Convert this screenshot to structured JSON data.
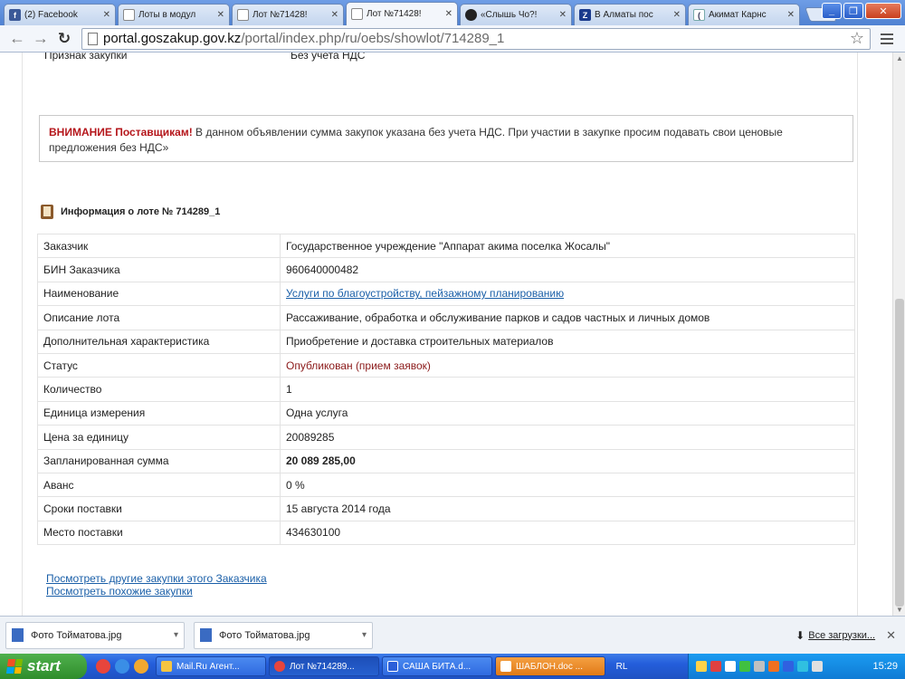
{
  "browser": {
    "tabs": [
      {
        "label": "(2) Facebook",
        "icon": "facebook-icon",
        "active": false
      },
      {
        "label": "Лоты в модул",
        "icon": "page-icon",
        "active": false
      },
      {
        "label": "Лот №71428!",
        "icon": "page-icon",
        "active": false
      },
      {
        "label": "Лот №71428!",
        "icon": "page-icon",
        "active": true
      },
      {
        "label": "«Слышь Чо?! ",
        "icon": "bomb-icon",
        "active": false
      },
      {
        "label": "В Алматы пос",
        "icon": "z-icon",
        "active": false
      },
      {
        "label": "Акимат Карнс",
        "icon": "crescent-icon",
        "active": false
      }
    ],
    "tab_close": "✕",
    "address_host": "portal.goszakup.gov.kz",
    "address_path": "/portal/index.php/ru/oebs/showlot/714289_1"
  },
  "page": {
    "top_row": {
      "label": "Признак закупки",
      "value": "Без учета НДС"
    },
    "notice": {
      "warning": "ВНИМАНИЕ Поставщикам!",
      "text": " В данном объявлении сумма закупок указана без учета НДС. При участии в закупке просим подавать свои ценовые предложения без НДС»"
    },
    "lot_heading": "Информация о лоте № 714289_1",
    "rows": [
      {
        "label": "Заказчик",
        "value": "Государственное учреждение \"Аппарат акима поселка Жосалы\""
      },
      {
        "label": "БИН Заказчика",
        "value": "960640000482"
      },
      {
        "label": "Наименование",
        "value": "Услуги по благоустройству, пейзажному планированию"
      },
      {
        "label": "Описание лота",
        "value": "Рассаживание, обработка и обслуживание  парков и садов частных и личных домов"
      },
      {
        "label": "Дополнительная характеристика",
        "value": "Приобретение и доставка строительных материалов"
      },
      {
        "label": "Статус",
        "value": "Опубликован (прием заявок)"
      },
      {
        "label": "Количество",
        "value": "1"
      },
      {
        "label": "Единица измерения",
        "value": "Одна услуга"
      },
      {
        "label": "Цена за единицу",
        "value": "20089285"
      },
      {
        "label": "Запланированная сумма",
        "value": "20 089 285,00"
      },
      {
        "label": "Аванс",
        "value": "0 %"
      },
      {
        "label": "Сроки поставки",
        "value": "15 августа 2014 года"
      },
      {
        "label": "Место поставки",
        "value": "434630100"
      }
    ],
    "links": {
      "other_purchases": "Посмотреть другие закупки этого Заказчика",
      "similar_purchases": "Посмотреть похожие закупки"
    }
  },
  "downloads": {
    "items": [
      "Фото Тойматова.jpg",
      "Фото Тойматова.jpg"
    ],
    "show_all": "Все загрузки..."
  },
  "taskbar": {
    "start": "start",
    "buttons": [
      {
        "label": "Mail.Ru Агент...",
        "color": "#f5c542"
      },
      {
        "label": "Лот №714289...",
        "color": "#e8453c"
      },
      {
        "label": "САША БИТА.d...",
        "color": "#2b5fd9"
      },
      {
        "label": "ШАБЛОН.doc ...",
        "color": "#ffffff"
      }
    ],
    "lang": "RL",
    "clock": "15:29"
  }
}
